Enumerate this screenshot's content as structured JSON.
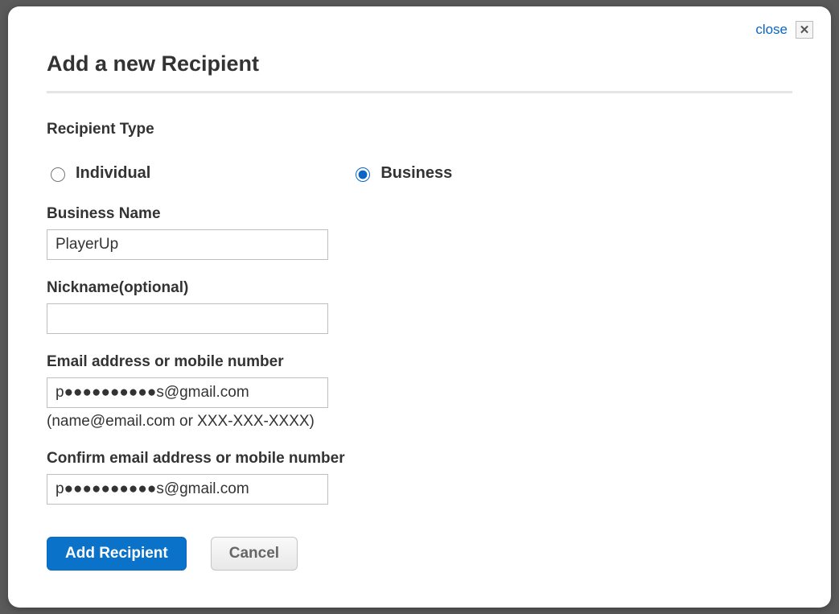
{
  "close_link": "close",
  "title": "Add a new Recipient",
  "recipient_type": {
    "label": "Recipient Type",
    "options": {
      "individual": "Individual",
      "business": "Business"
    },
    "selected": "business"
  },
  "fields": {
    "business_name": {
      "label": "Business Name",
      "value": "PlayerUp"
    },
    "nickname": {
      "label": "Nickname(optional)",
      "value": ""
    },
    "email": {
      "label": "Email address or mobile number",
      "value": "p●●●●●●●●●●s@gmail.com",
      "hint": "(name@email.com or XXX-XXX-XXXX)"
    },
    "confirm_email": {
      "label": "Confirm email address or mobile number",
      "value": "p●●●●●●●●●●s@gmail.com"
    }
  },
  "buttons": {
    "add": "Add Recipient",
    "cancel": "Cancel"
  }
}
